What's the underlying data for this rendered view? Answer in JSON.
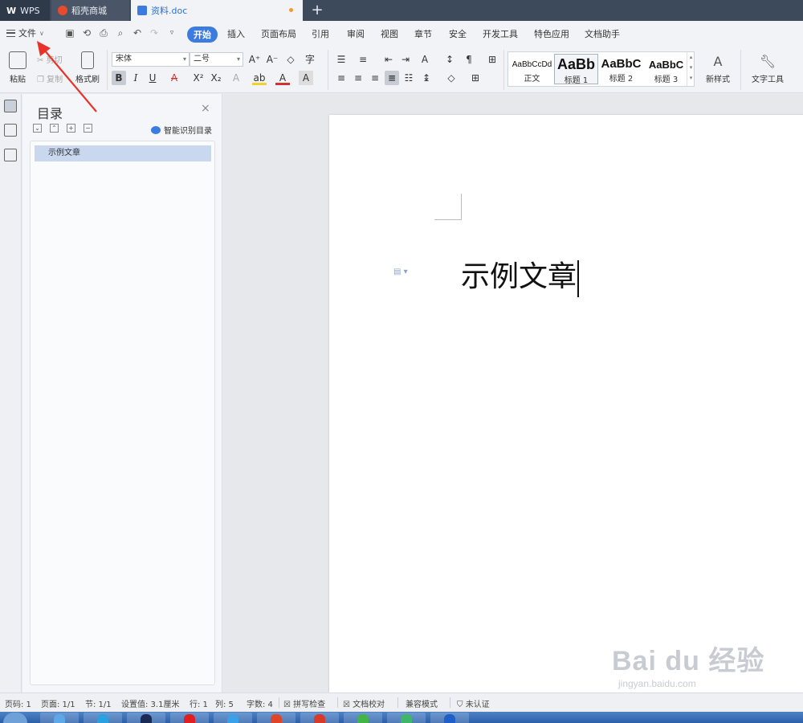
{
  "titlebar": {
    "tabs": [
      {
        "label": "WPS"
      },
      {
        "label": "稻壳商城"
      },
      {
        "label": "资料.doc"
      }
    ],
    "new_tab": "+"
  },
  "menubar": {
    "file_label": "文件",
    "items": [
      "开始",
      "插入",
      "页面布局",
      "引用",
      "审阅",
      "视图",
      "章节",
      "安全",
      "开发工具",
      "特色应用",
      "文档助手"
    ],
    "active": "开始"
  },
  "ribbon": {
    "paste": "粘贴",
    "cut": "剪切",
    "copy": "复制",
    "format_painter": "格式刷",
    "font_name": "宋体",
    "font_size": "二号",
    "styles": [
      {
        "sample": "AaBbCcDd",
        "name": "正文"
      },
      {
        "sample": "AaBb",
        "name": "标题 1"
      },
      {
        "sample": "AaBbC",
        "name": "标题 2"
      },
      {
        "sample": "AaBbC",
        "name": "标题 3"
      }
    ],
    "new_style": "新样式",
    "text_tools": "文字工具"
  },
  "toc": {
    "title": "目录",
    "close": "×",
    "smart_label": "智能识别目录",
    "items": [
      "示例文章"
    ]
  },
  "document": {
    "text": "示例文章"
  },
  "watermark": {
    "brand": "Bai du 经验",
    "url": "jingyan.baidu.com"
  },
  "status": {
    "page_code": "页码: 1",
    "page": "页面: 1/1",
    "section": "节: 1/1",
    "setting": "设置值: 3.1厘米",
    "row": "行: 1",
    "col": "列: 5",
    "word_count": "字数: 4",
    "spell_check": "拼写检查",
    "doc_proof": "文档校对",
    "compat_mode": "兼容模式",
    "cert": "未认证"
  },
  "colors": {
    "accent": "#3c7be0",
    "titlebar": "#3d4a5c",
    "arrow": "#e8332a"
  }
}
